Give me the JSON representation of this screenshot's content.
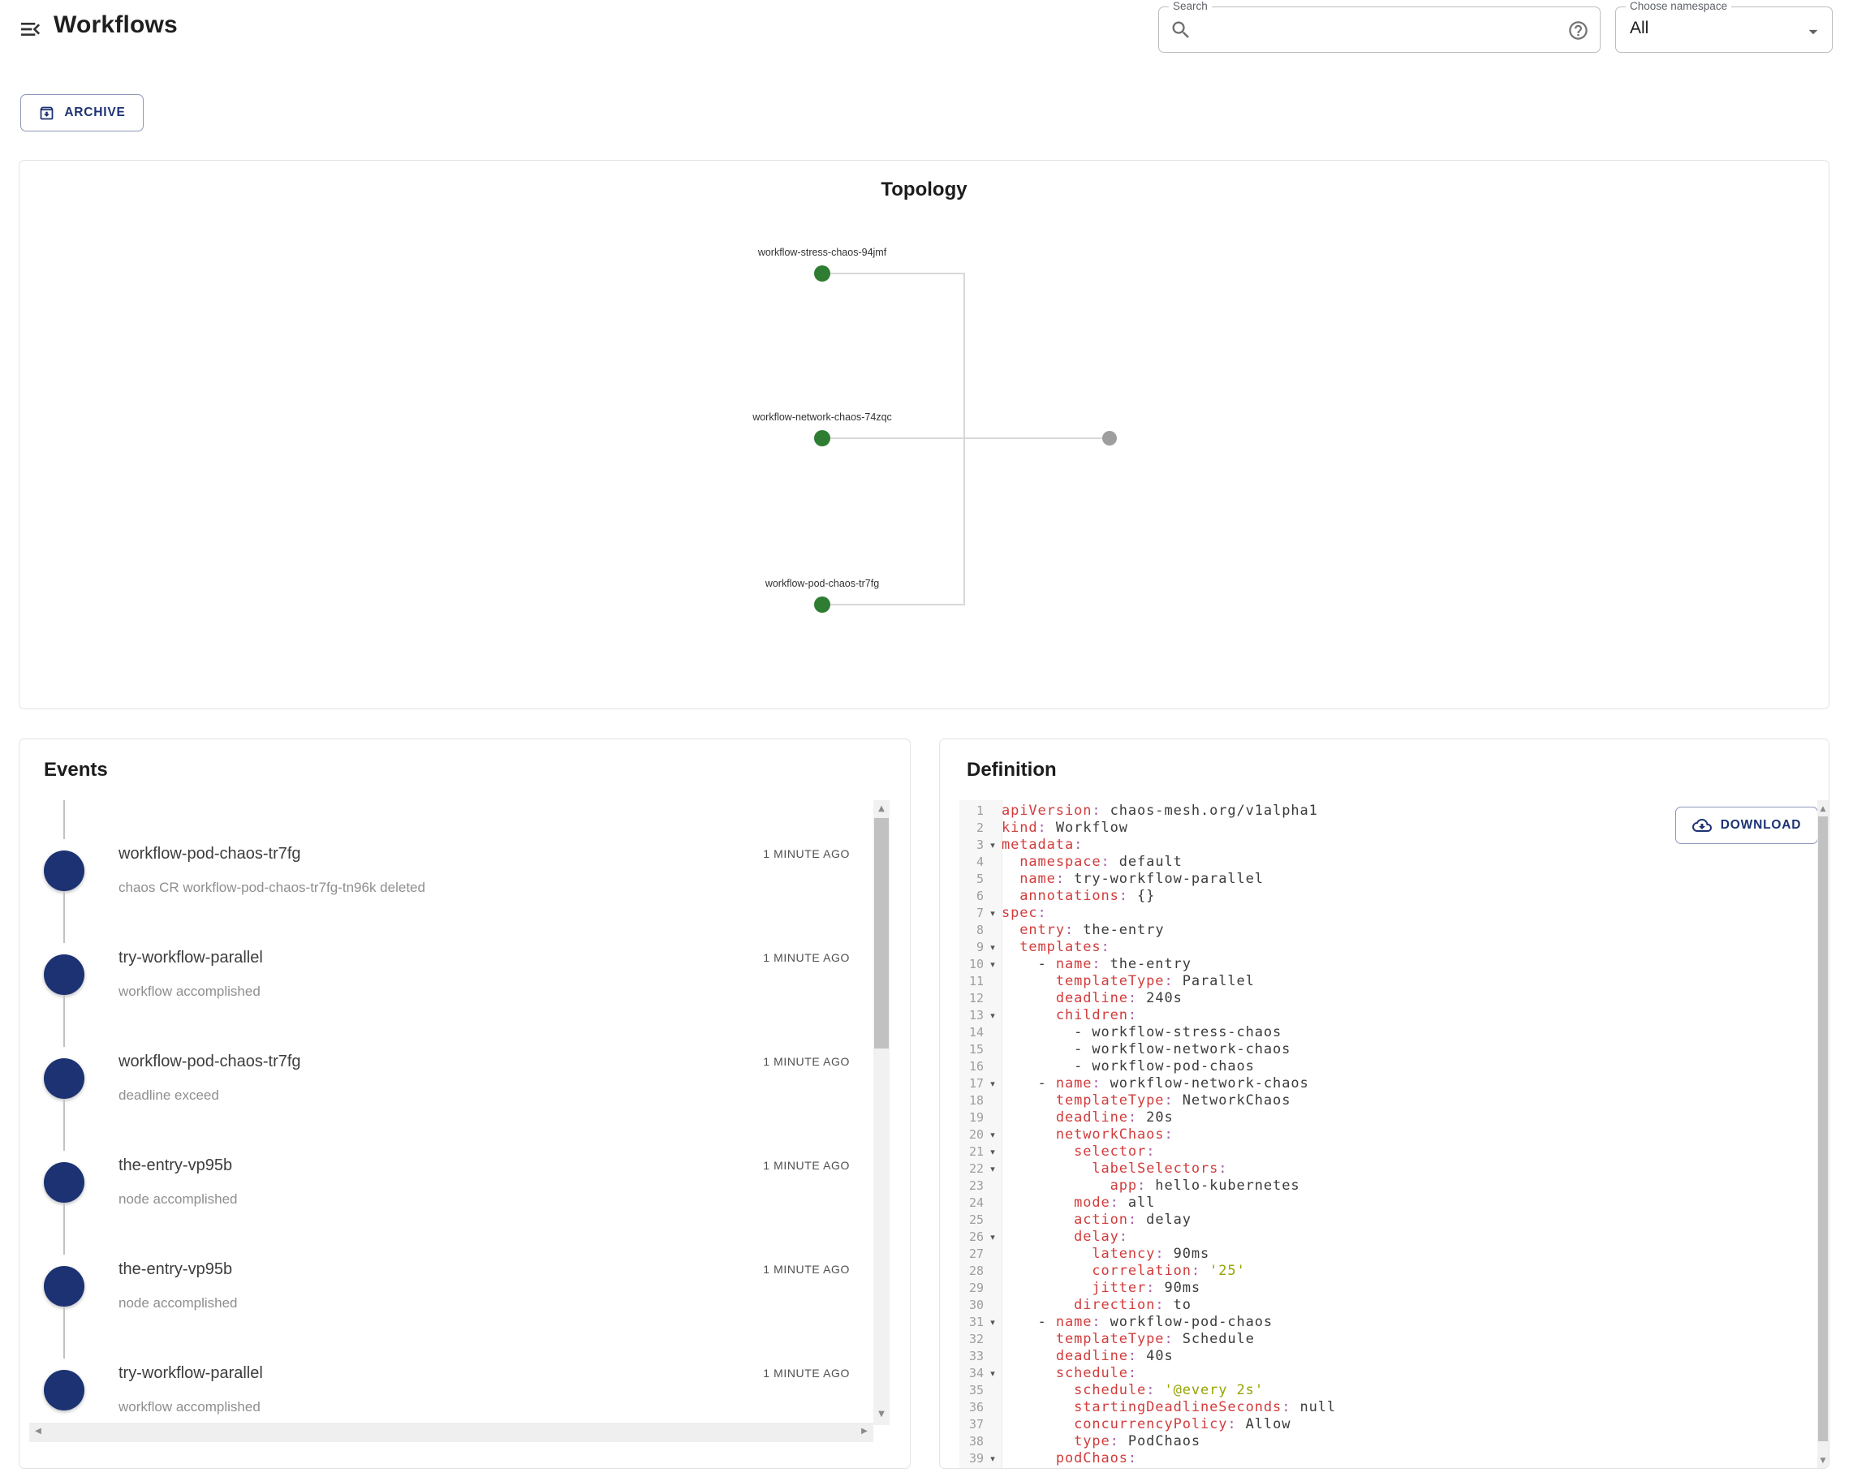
{
  "header": {
    "title": "Workflows",
    "search_label": "Search",
    "search_value": "",
    "namespace_label": "Choose namespace",
    "namespace_value": "All"
  },
  "toolbar": {
    "archive_label": "ARCHIVE"
  },
  "icons": {
    "menu": "menu-open",
    "search": "magnifier",
    "help": "question-circle",
    "namespace_arrow": "triangle-down",
    "archive": "archive-box-down",
    "download": "cloud-download",
    "fold_marker": "triangle-down",
    "scrollbar_arrows": "triangle-up/down/left/right"
  },
  "colors": {
    "navy": "#1c3273",
    "node_green": "#2e7d32",
    "node_gray": "#9e9e9e",
    "edge_gray": "#d8d8d8",
    "key_red": "#d23c3c",
    "punct_purple": "#a55ea4",
    "string_olive": "#97a300"
  },
  "topology": {
    "title": "Topology",
    "nodes": [
      {
        "label": "workflow-stress-chaos-94jmf",
        "status": "green"
      },
      {
        "label": "workflow-network-chaos-74zqc",
        "status": "green"
      },
      {
        "label": "workflow-pod-chaos-tr7fg",
        "status": "green"
      },
      {
        "label": "",
        "status": "gray"
      }
    ]
  },
  "events": {
    "title": "Events",
    "items": [
      {
        "name": "workflow-pod-chaos-tr7fg",
        "message": "chaos CR workflow-pod-chaos-tr7fg-tn96k deleted",
        "time": "1 MINUTE AGO"
      },
      {
        "name": "try-workflow-parallel",
        "message": "workflow accomplished",
        "time": "1 MINUTE AGO"
      },
      {
        "name": "workflow-pod-chaos-tr7fg",
        "message": "deadline exceed",
        "time": "1 MINUTE AGO"
      },
      {
        "name": "the-entry-vp95b",
        "message": "node accomplished",
        "time": "1 MINUTE AGO"
      },
      {
        "name": "the-entry-vp95b",
        "message": "node accomplished",
        "time": "1 MINUTE AGO"
      },
      {
        "name": "try-workflow-parallel",
        "message": "workflow accomplished",
        "time": "1 MINUTE AGO"
      }
    ]
  },
  "definition": {
    "title": "Definition",
    "download_label": "DOWNLOAD",
    "lines": [
      {
        "num": 1,
        "fold": false,
        "segments": [
          [
            "k",
            "apiVersion"
          ],
          [
            "p",
            ":"
          ],
          [
            "v",
            " chaos-mesh.org/v1alpha1"
          ]
        ]
      },
      {
        "num": 2,
        "fold": false,
        "segments": [
          [
            "k",
            "kind"
          ],
          [
            "p",
            ":"
          ],
          [
            "v",
            " Workflow"
          ]
        ]
      },
      {
        "num": 3,
        "fold": true,
        "segments": [
          [
            "k",
            "metadata"
          ],
          [
            "p",
            ":"
          ]
        ]
      },
      {
        "num": 4,
        "fold": false,
        "segments": [
          [
            "v",
            "  "
          ],
          [
            "k",
            "namespace"
          ],
          [
            "p",
            ":"
          ],
          [
            "v",
            " default"
          ]
        ]
      },
      {
        "num": 5,
        "fold": false,
        "segments": [
          [
            "v",
            "  "
          ],
          [
            "k",
            "name"
          ],
          [
            "p",
            ":"
          ],
          [
            "v",
            " try-workflow-parallel"
          ]
        ]
      },
      {
        "num": 6,
        "fold": false,
        "segments": [
          [
            "v",
            "  "
          ],
          [
            "k",
            "annotations"
          ],
          [
            "p",
            ":"
          ],
          [
            "v",
            " {}"
          ]
        ]
      },
      {
        "num": 7,
        "fold": true,
        "segments": [
          [
            "k",
            "spec"
          ],
          [
            "p",
            ":"
          ]
        ]
      },
      {
        "num": 8,
        "fold": false,
        "segments": [
          [
            "v",
            "  "
          ],
          [
            "k",
            "entry"
          ],
          [
            "p",
            ":"
          ],
          [
            "v",
            " the-entry"
          ]
        ]
      },
      {
        "num": 9,
        "fold": true,
        "segments": [
          [
            "v",
            "  "
          ],
          [
            "k",
            "templates"
          ],
          [
            "p",
            ":"
          ]
        ]
      },
      {
        "num": 10,
        "fold": true,
        "segments": [
          [
            "v",
            "    - "
          ],
          [
            "k",
            "name"
          ],
          [
            "p",
            ":"
          ],
          [
            "v",
            " the-entry"
          ]
        ]
      },
      {
        "num": 11,
        "fold": false,
        "segments": [
          [
            "v",
            "      "
          ],
          [
            "k",
            "templateType"
          ],
          [
            "p",
            ":"
          ],
          [
            "v",
            " Parallel"
          ]
        ]
      },
      {
        "num": 12,
        "fold": false,
        "segments": [
          [
            "v",
            "      "
          ],
          [
            "k",
            "deadline"
          ],
          [
            "p",
            ":"
          ],
          [
            "v",
            " 240s"
          ]
        ]
      },
      {
        "num": 13,
        "fold": true,
        "segments": [
          [
            "v",
            "      "
          ],
          [
            "k",
            "children"
          ],
          [
            "p",
            ":"
          ]
        ]
      },
      {
        "num": 14,
        "fold": false,
        "segments": [
          [
            "v",
            "        - workflow-stress-chaos"
          ]
        ]
      },
      {
        "num": 15,
        "fold": false,
        "segments": [
          [
            "v",
            "        - workflow-network-chaos"
          ]
        ]
      },
      {
        "num": 16,
        "fold": false,
        "segments": [
          [
            "v",
            "        - workflow-pod-chaos"
          ]
        ]
      },
      {
        "num": 17,
        "fold": true,
        "segments": [
          [
            "v",
            "    - "
          ],
          [
            "k",
            "name"
          ],
          [
            "p",
            ":"
          ],
          [
            "v",
            " workflow-network-chaos"
          ]
        ]
      },
      {
        "num": 18,
        "fold": false,
        "segments": [
          [
            "v",
            "      "
          ],
          [
            "k",
            "templateType"
          ],
          [
            "p",
            ":"
          ],
          [
            "v",
            " NetworkChaos"
          ]
        ]
      },
      {
        "num": 19,
        "fold": false,
        "segments": [
          [
            "v",
            "      "
          ],
          [
            "k",
            "deadline"
          ],
          [
            "p",
            ":"
          ],
          [
            "v",
            " 20s"
          ]
        ]
      },
      {
        "num": 20,
        "fold": true,
        "segments": [
          [
            "v",
            "      "
          ],
          [
            "k",
            "networkChaos"
          ],
          [
            "p",
            ":"
          ]
        ]
      },
      {
        "num": 21,
        "fold": true,
        "segments": [
          [
            "v",
            "        "
          ],
          [
            "k",
            "selector"
          ],
          [
            "p",
            ":"
          ]
        ]
      },
      {
        "num": 22,
        "fold": true,
        "segments": [
          [
            "v",
            "          "
          ],
          [
            "k",
            "labelSelectors"
          ],
          [
            "p",
            ":"
          ]
        ]
      },
      {
        "num": 23,
        "fold": false,
        "segments": [
          [
            "v",
            "            "
          ],
          [
            "k",
            "app"
          ],
          [
            "p",
            ":"
          ],
          [
            "v",
            " hello-kubernetes"
          ]
        ]
      },
      {
        "num": 24,
        "fold": false,
        "segments": [
          [
            "v",
            "        "
          ],
          [
            "k",
            "mode"
          ],
          [
            "p",
            ":"
          ],
          [
            "v",
            " all"
          ]
        ]
      },
      {
        "num": 25,
        "fold": false,
        "segments": [
          [
            "v",
            "        "
          ],
          [
            "k",
            "action"
          ],
          [
            "p",
            ":"
          ],
          [
            "v",
            " delay"
          ]
        ]
      },
      {
        "num": 26,
        "fold": true,
        "segments": [
          [
            "v",
            "        "
          ],
          [
            "k",
            "delay"
          ],
          [
            "p",
            ":"
          ]
        ]
      },
      {
        "num": 27,
        "fold": false,
        "segments": [
          [
            "v",
            "          "
          ],
          [
            "k",
            "latency"
          ],
          [
            "p",
            ":"
          ],
          [
            "v",
            " 90ms"
          ]
        ]
      },
      {
        "num": 28,
        "fold": false,
        "segments": [
          [
            "v",
            "          "
          ],
          [
            "k",
            "correlation"
          ],
          [
            "p",
            ":"
          ],
          [
            "v",
            " "
          ],
          [
            "s",
            "'25'"
          ]
        ]
      },
      {
        "num": 29,
        "fold": false,
        "segments": [
          [
            "v",
            "          "
          ],
          [
            "k",
            "jitter"
          ],
          [
            "p",
            ":"
          ],
          [
            "v",
            " 90ms"
          ]
        ]
      },
      {
        "num": 30,
        "fold": false,
        "segments": [
          [
            "v",
            "        "
          ],
          [
            "k",
            "direction"
          ],
          [
            "p",
            ":"
          ],
          [
            "v",
            " to"
          ]
        ]
      },
      {
        "num": 31,
        "fold": true,
        "segments": [
          [
            "v",
            "    - "
          ],
          [
            "k",
            "name"
          ],
          [
            "p",
            ":"
          ],
          [
            "v",
            " workflow-pod-chaos"
          ]
        ]
      },
      {
        "num": 32,
        "fold": false,
        "segments": [
          [
            "v",
            "      "
          ],
          [
            "k",
            "templateType"
          ],
          [
            "p",
            ":"
          ],
          [
            "v",
            " Schedule"
          ]
        ]
      },
      {
        "num": 33,
        "fold": false,
        "segments": [
          [
            "v",
            "      "
          ],
          [
            "k",
            "deadline"
          ],
          [
            "p",
            ":"
          ],
          [
            "v",
            " 40s"
          ]
        ]
      },
      {
        "num": 34,
        "fold": true,
        "segments": [
          [
            "v",
            "      "
          ],
          [
            "k",
            "schedule"
          ],
          [
            "p",
            ":"
          ]
        ]
      },
      {
        "num": 35,
        "fold": false,
        "segments": [
          [
            "v",
            "        "
          ],
          [
            "k",
            "schedule"
          ],
          [
            "p",
            ":"
          ],
          [
            "v",
            " "
          ],
          [
            "s",
            "'@every 2s'"
          ]
        ]
      },
      {
        "num": 36,
        "fold": false,
        "segments": [
          [
            "v",
            "        "
          ],
          [
            "k",
            "startingDeadlineSeconds"
          ],
          [
            "p",
            ":"
          ],
          [
            "v",
            " null"
          ]
        ]
      },
      {
        "num": 37,
        "fold": false,
        "segments": [
          [
            "v",
            "        "
          ],
          [
            "k",
            "concurrencyPolicy"
          ],
          [
            "p",
            ":"
          ],
          [
            "v",
            " Allow"
          ]
        ]
      },
      {
        "num": 38,
        "fold": false,
        "segments": [
          [
            "v",
            "        "
          ],
          [
            "k",
            "type"
          ],
          [
            "p",
            ":"
          ],
          [
            "v",
            " PodChaos"
          ]
        ]
      },
      {
        "num": 39,
        "fold": true,
        "segments": [
          [
            "v",
            "      "
          ],
          [
            "k",
            "podChaos"
          ],
          [
            "p",
            ":"
          ]
        ]
      }
    ]
  }
}
